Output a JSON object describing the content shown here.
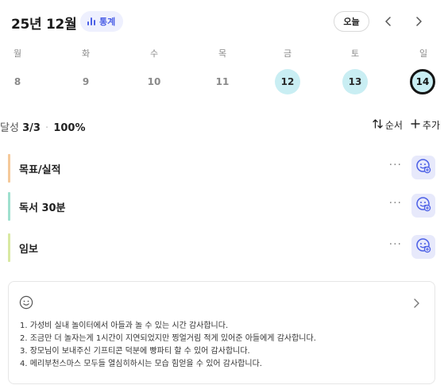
{
  "header": {
    "month_title": "25년 12월",
    "stats_label": "통계",
    "today_label": "오늘"
  },
  "week": {
    "weekdays": [
      "월",
      "화",
      "수",
      "목",
      "금",
      "토",
      "일"
    ],
    "dates": [
      "8",
      "9",
      "10",
      "11",
      "12",
      "13",
      "14"
    ],
    "completed_dates": [
      "12",
      "13"
    ],
    "current_date": "14"
  },
  "summary": {
    "label": "달성",
    "count": "3/3",
    "separator": "·",
    "percent": "100%",
    "sort_label": "순서",
    "add_label": "추가"
  },
  "tasks": [
    {
      "label": "목표/실적",
      "bar_color": "#f5c99a",
      "more": "···"
    },
    {
      "label": "독서 30분",
      "bar_color": "#9fe0cf",
      "more": "···"
    },
    {
      "label": "임보",
      "bar_color": "#d9e9a2",
      "more": "···"
    }
  ],
  "gratitude": {
    "lines": [
      "1. 가성비 실내 놀이터에서 아들과 놀 수 있는 시간 감사합니다.",
      "2. 조금만 더 놀자는게 1시간이 지연되었지만 찡얼거림 적게 있어준 아들에게 감사합니다.",
      "3. 장모님이 보내주신 기프티콘 덕분에 빵파티 할 수 있어 감사합니다.",
      "4. 메리부천스마스 모두들 열심히하시는 모습 힘얻을 수 있어 감사합니다."
    ]
  },
  "colors": {
    "accent": "#4b5fe6",
    "completed_date_bg": "#c9eef3",
    "emoji_button_bg": "#e7e9fb"
  },
  "icons": {
    "stats": "bar-chart-icon",
    "prev": "chevron-left-icon",
    "next": "chevron-right-icon",
    "sort": "sort-arrows-icon",
    "add": "plus-icon",
    "task_reaction": "smiley-add-icon",
    "gratitude": "smiley-icon",
    "gratitude_open": "chevron-right-icon"
  }
}
